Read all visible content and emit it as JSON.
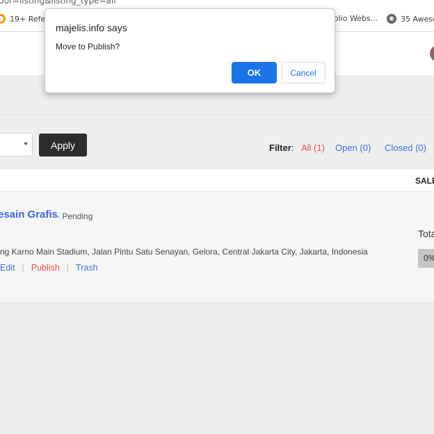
{
  "browser": {
    "url_fragment": "dor=listing&listing_type=all",
    "bookmarks": [
      {
        "label": "19+ Refer",
        "icon": "orange-ring-icon"
      },
      {
        "label": "folio Webs...",
        "icon": ""
      },
      {
        "label": "35 Awesc",
        "icon": "globe-icon"
      }
    ]
  },
  "dialog": {
    "title": "majelis.info says",
    "message": "Move to Publish?",
    "ok_label": "OK",
    "cancel_label": "Cancel"
  },
  "toolbar": {
    "apply_label": "Apply",
    "filter_label": "Filter",
    "filter_colon": ":",
    "filters": [
      {
        "label": "All (1)",
        "color": "#e4524c"
      },
      {
        "label": "Open (0)",
        "color": "#3e6fd8"
      },
      {
        "label": "Closed (0)",
        "color": "#3e6fd8"
      }
    ]
  },
  "table": {
    "header_sales": "SALE",
    "rows": [
      {
        "title": "esain Grafis",
        "status": "- Pending",
        "address": "ng Karno Main Stadium, Jalan Pintu Satu Senayan, Gelora, Central Jakarta City, Jakarta, Indonesia",
        "actions": [
          "Edit",
          "Publish",
          "Trash"
        ],
        "total_label": "Tota",
        "progress_text": "0%"
      }
    ]
  },
  "colors": {
    "accent_blue": "#1a73e8",
    "link_blue": "#3e6fd8",
    "link_red": "#e4524c",
    "apply_dark": "#2d2d2d"
  }
}
